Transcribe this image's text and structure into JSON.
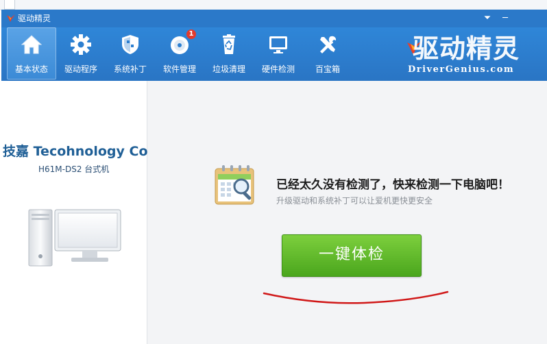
{
  "window": {
    "title": "驱动精灵",
    "menu_glyph": "⏷",
    "minimize_glyph": "─"
  },
  "toolbar": {
    "items": [
      {
        "label": "基本状态",
        "icon": "home-icon",
        "active": true
      },
      {
        "label": "驱动程序",
        "icon": "gear-icon",
        "active": false
      },
      {
        "label": "系统补丁",
        "icon": "shield-icon",
        "active": false
      },
      {
        "label": "软件管理",
        "icon": "disc-icon",
        "active": false,
        "badge": "1"
      },
      {
        "label": "垃圾清理",
        "icon": "recycle-bin-icon",
        "active": false
      },
      {
        "label": "硬件检测",
        "icon": "monitor-icon",
        "active": false
      },
      {
        "label": "百宝箱",
        "icon": "tools-icon",
        "active": false
      }
    ]
  },
  "brand": {
    "cn": "驱动精灵",
    "en": "DriverGenius.com"
  },
  "sidebar": {
    "vendor": "技嘉 Tecohnology Co.,",
    "model": "H61M-DS2 台式机"
  },
  "main": {
    "message": "已经太久没有检测了，快来检测一下电脑吧！",
    "sub_message": "升级驱动和系统补丁可以让爱机更快更安全",
    "check_button": "一键体检"
  },
  "colors": {
    "titlebar": "#2b79c9",
    "toolbar": "#2d7fd0",
    "button_green": "#5cb82a",
    "annotation_red": "#d01818"
  }
}
